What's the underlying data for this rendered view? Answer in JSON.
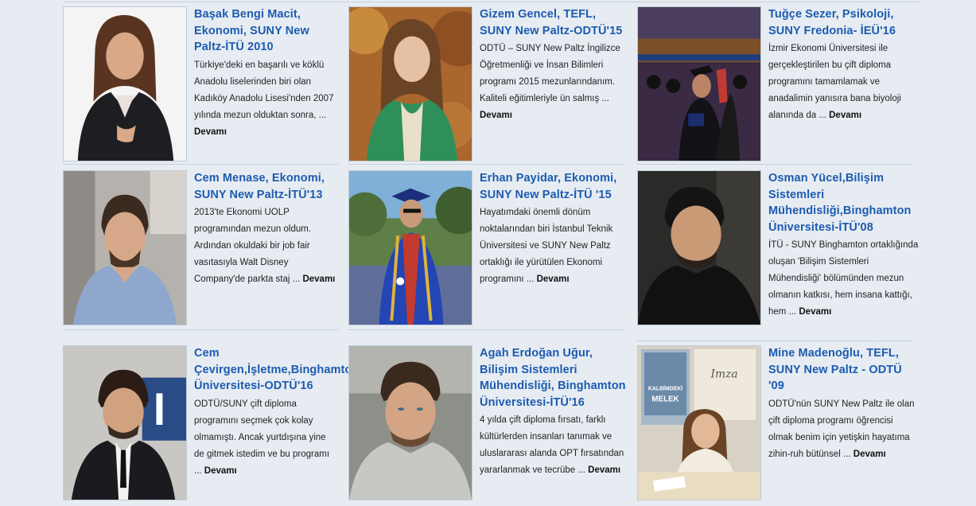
{
  "colors": {
    "background": "#e6ecf2",
    "title_link": "#1d5bb0",
    "body_text": "#222222"
  },
  "read_more_label": "Devamı",
  "ellipsis": "...",
  "testimonials": [
    {
      "title": "Başak Bengi Macit, Ekonomi, SUNY New Paltz-İTÜ 2010",
      "excerpt": "Türkiye'deki en başarılı ve köklü Anadolu liselerinden biri olan Kadıköy Anadolu Lisesi'nden 2007 yılında mezun olduktan sonra,",
      "photo": "woman-in-black-blazer-photo"
    },
    {
      "title": "Gizem Gencel, TEFL, SUNY New Paltz-ODTÜ'15",
      "excerpt": "ODTÜ – SUNY New Paltz İngilizce Öğretmenliği ve İnsan Bilimleri programı 2015 mezunlarındanım.  Kaliteli eğitimleriyle ün salmış",
      "photo": "woman-green-cardigan-autumn-photo"
    },
    {
      "title": "Tuğçe Sezer, Psikoloji, SUNY Fredonia- İEÜ'16",
      "excerpt": "İzmir Ekonomi Üniversitesi ile gerçekleştirilen bu çift diploma programını tamamlamak ve anadalimin yanısıra bana biyoloji alanında da",
      "photo": "graduation-ceremony-photo"
    },
    {
      "title": "Cem Menase, Ekonomi, SUNY New Paltz-İTÜ'13",
      "excerpt": "2013'te Ekonomi UOLP programından mezun oldum. Ardından okuldaki bir job fair vasıtasıyla Walt Disney Company'de parkta staj",
      "photo": "man-blue-shirt-photo"
    },
    {
      "title": "Erhan Payidar, Ekonomi, SUNY New Paltz-İTÜ '15",
      "excerpt": "Hayatımdaki önemli dönüm noktalarından biri İstanbul Teknik Üniversitesi ve SUNY New Paltz ortaklığı ile yürütülen Ekonomi programını",
      "photo": "graduate-in-blue-gown-photo"
    },
    {
      "title": "Osman Yücel,Bilişim Sistemleri Mühendisliği,Binghamton Üniversitesi-İTÜ'08",
      "excerpt": "İTÜ - SUNY Binghamton ortaklığında oluşan 'Bilişim Sistemleri Mühendisliği' bölümünden mezun olmanın katkısı, hem insana kattığı, hem",
      "photo": "man-dark-sweater-photo"
    },
    {
      "title": "Cem Çevirgen,İşletme,Binghamton Üniversitesi-ODTÜ'16",
      "excerpt": "ODTÜ/SUNY çift diploma programını seçmek çok kolay olmamıştı. Ancak yurtdışına yine de gitmek istedim ve bu programı",
      "photo": "man-suit-tie-photo"
    },
    {
      "title": "Agah Erdoğan Uğur, Bilişim Sistemleri Mühendisliği, Binghamton Üniversitesi-İTÜ'16",
      "excerpt": "4 yılda çift diploma fırsatı, farklı kültürlerden insanları tanımak ve uluslararası alanda OPT fırsatından yararlanmak ve tecrübe",
      "photo": "man-grey-hoodie-photo"
    },
    {
      "title": "Mine Madenoğlu, TEFL, SUNY New Paltz - ODTÜ '09",
      "excerpt": "ODTÜ'nün SUNY New Paltz ile olan çift diploma programı öğrencisi olmak benim için yetişkin hayatıma zihin-ruh bütünsel",
      "photo": "woman-book-signing-photo",
      "poster_text": [
        "Imza",
        "KALBİMDEKİ",
        "MELEK"
      ]
    }
  ]
}
